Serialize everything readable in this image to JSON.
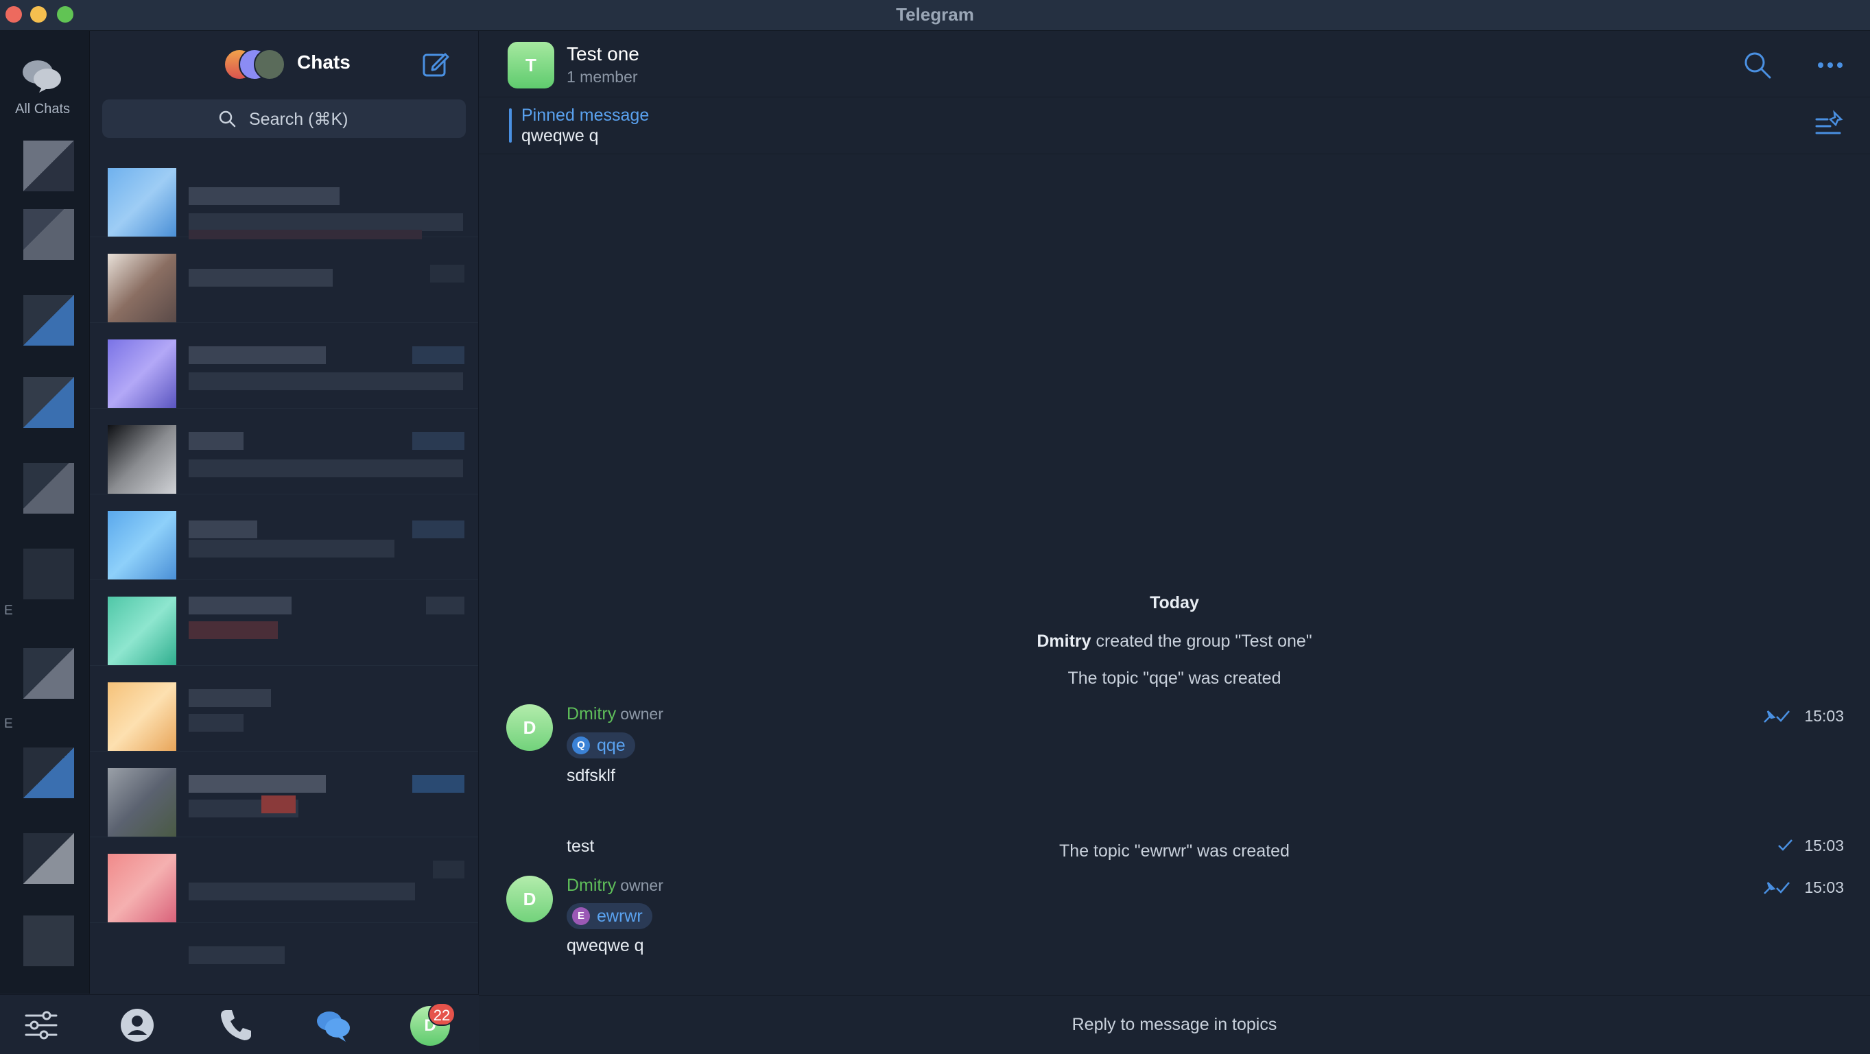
{
  "window": {
    "title": "Telegram"
  },
  "rail": {
    "all_chats_label": "All Chats",
    "edge_letters": [
      "E",
      "E"
    ]
  },
  "chat_list": {
    "title": "Chats",
    "search_placeholder": "Search (⌘K)"
  },
  "tabs": {
    "badge_count": "22",
    "profile_initial": "D"
  },
  "chat": {
    "avatar_initial": "T",
    "name": "Test one",
    "subtitle": "1 member",
    "pinned": {
      "title": "Pinned message",
      "text": "qweqwe q"
    },
    "date_separator": "Today",
    "service_created": {
      "actor": "Dmitry",
      "text": " created the group \"Test one\""
    },
    "service_topic_1": "The topic \"qqe\" was created",
    "service_topic_2": "The topic \"ewrwr\" was created",
    "messages": [
      {
        "initial": "D",
        "sender": "Dmitry",
        "role": "owner",
        "topic": "qqe",
        "topic_initial": "Q",
        "text": "sdfsklf",
        "time": "15:03"
      },
      {
        "text": "test",
        "time": "15:03"
      },
      {
        "initial": "D",
        "sender": "Dmitry",
        "role": "owner",
        "topic": "ewrwr",
        "topic_initial": "E",
        "text": "qweqwe q",
        "time": "15:03"
      }
    ],
    "composer_text": "Reply to message in topics"
  },
  "colors": {
    "accent": "#5aa2f0",
    "sender": "#5fbf5a",
    "badge": "#e5534b"
  }
}
